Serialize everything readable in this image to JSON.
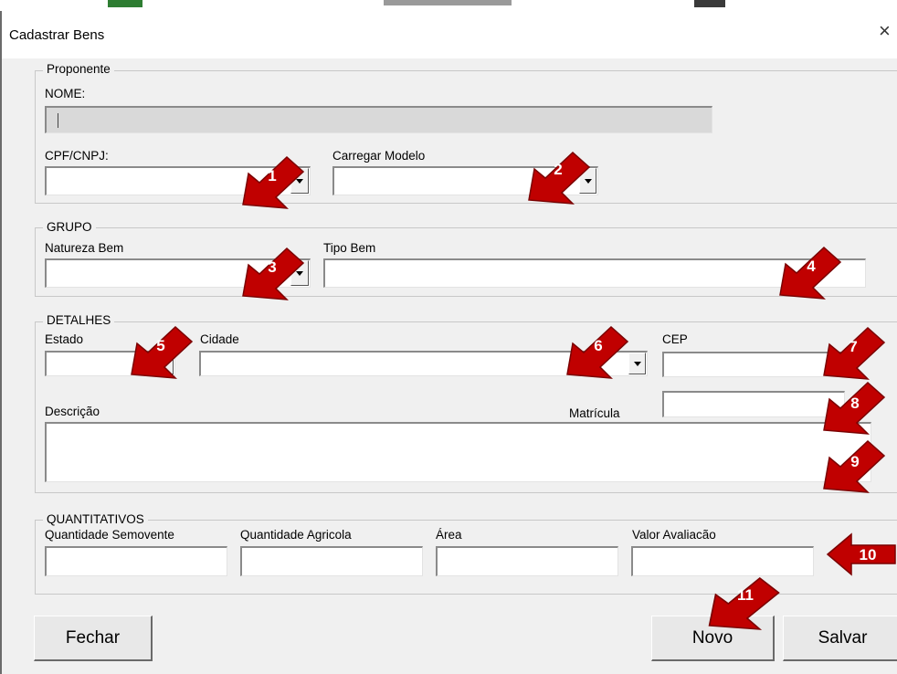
{
  "window": {
    "title": "Cadastrar Bens",
    "close_glyph": "×"
  },
  "proponente": {
    "legend": "Proponente",
    "nome_label": "NOME:",
    "nome_value": "",
    "cpf_label": "CPF/CNPJ:",
    "cpf_value": "",
    "modelo_label": "Carregar Modelo",
    "modelo_value": ""
  },
  "grupo": {
    "legend": "GRUPO",
    "natureza_label": "Natureza Bem",
    "natureza_value": "",
    "tipo_label": "Tipo Bem",
    "tipo_value": ""
  },
  "detalhes": {
    "legend": "DETALHES",
    "estado_label": "Estado",
    "estado_value": "",
    "cidade_label": "Cidade",
    "cidade_value": "",
    "cep_label": "CEP",
    "cep_value": "",
    "matricula_label": "Matrícula",
    "matricula_value": "",
    "descricao_label": "Descrição",
    "descricao_value": ""
  },
  "quantitativos": {
    "legend": "QUANTITATIVOS",
    "semovente_label": "Quantidade Semovente",
    "agricola_label": "Quantidade Agricola",
    "area_label": "Área",
    "valor_label": "Valor Avaliacão",
    "semovente_value": "",
    "agricola_value": "",
    "area_value": "",
    "valor_value": ""
  },
  "buttons": {
    "fechar": "Fechar",
    "novo": "Novo",
    "salvar": "Salvar"
  },
  "annotations": [
    "1",
    "2",
    "3",
    "4",
    "5",
    "6",
    "7",
    "8",
    "9",
    "10",
    "11"
  ],
  "colors": {
    "arrow_fill": "#c00000",
    "arrow_stroke": "#7a0000",
    "form_bg": "#f0f0f0",
    "disabled_field": "#d9d9d9"
  },
  "icons": {
    "dropdown": "chevron-down-icon",
    "close": "close-icon",
    "annotation": "callout-arrow-icon"
  }
}
